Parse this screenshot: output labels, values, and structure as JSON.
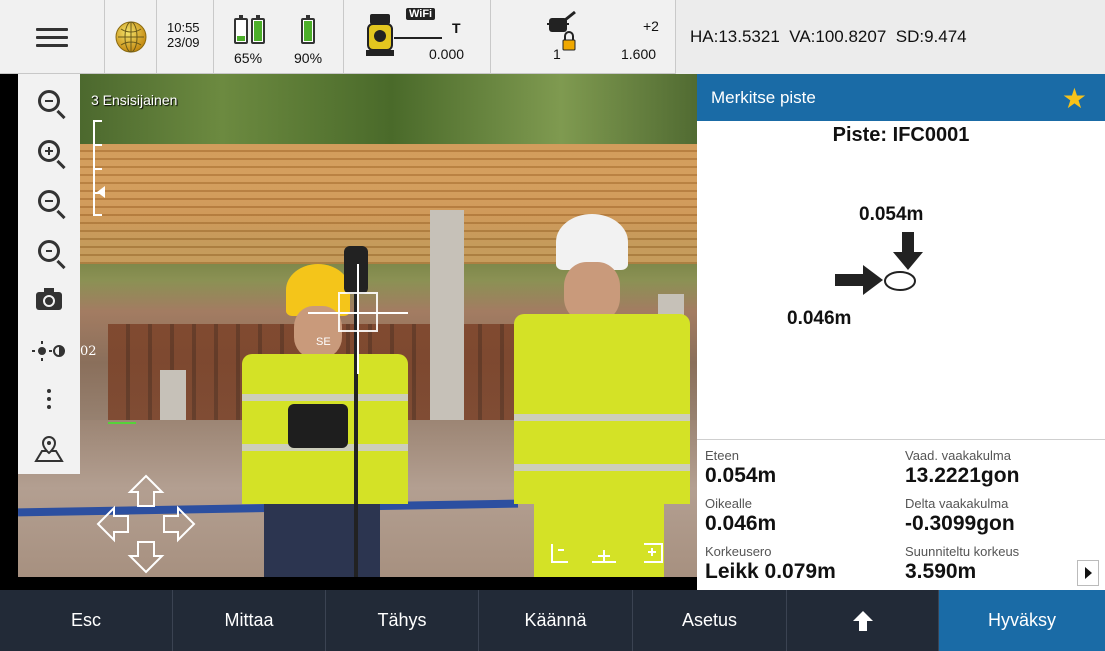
{
  "status_bar": {
    "time": "10:55",
    "date": "23/09",
    "battery_left_percent": "65%",
    "battery_right_percent": "90%",
    "battery_left_level": 0.25,
    "battery_right_level": 0.9,
    "wifi_label": "WiFi",
    "instrument_mode": "T",
    "instrument_value": "0.000",
    "target_number": "1",
    "target_offset": "+2",
    "target_height": "1.600",
    "hva_readout": "HA:13.5321  VA:100.8207  SD:9.474",
    "icons": {
      "menu": "hamburger-menu-icon",
      "globe": "globe-icon",
      "instrument": "total-station-icon",
      "target": "prism-target-icon"
    }
  },
  "camera": {
    "view_label": "3 Ensisijainen",
    "crosshair_label": "SE",
    "side_number": "02"
  },
  "left_tools": [
    "zoom-extents-icon",
    "zoom-in-icon",
    "zoom-out-icon",
    "zoom-previous-icon",
    "camera-icon",
    "brightness-contrast-icon",
    "more-options-icon",
    "map-pin-icon"
  ],
  "panel": {
    "header": "Merkitse piste",
    "point_title": "Piste: IFC0001",
    "forward_delta": "0.054m",
    "right_delta": "0.046m",
    "stats": {
      "eteen_label": "Eteen",
      "eteen_value": "0.054m",
      "oikealle_label": "Oikealle",
      "oikealle_value": "0.046m",
      "korkeusero_label": "Korkeusero",
      "korkeusero_value": "Leikk 0.079m",
      "vaad_label": "Vaad. vaakakulma",
      "vaad_value": "13.2221gon",
      "delta_label": "Delta vaakakulma",
      "delta_value": "-0.3099gon",
      "suunniteltu_label": "Suunniteltu korkeus",
      "suunniteltu_value": "3.590m"
    },
    "colors": {
      "header_bg": "#1a6ba6",
      "star": "#f6c21a"
    }
  },
  "bottom_buttons": {
    "esc": "Esc",
    "mittaa": "Mittaa",
    "tahys": "Tähys",
    "kaanna": "Käännä",
    "asetus": "Asetus",
    "up_icon": "arrow-up-icon",
    "hyvaksy": "Hyväksy"
  }
}
